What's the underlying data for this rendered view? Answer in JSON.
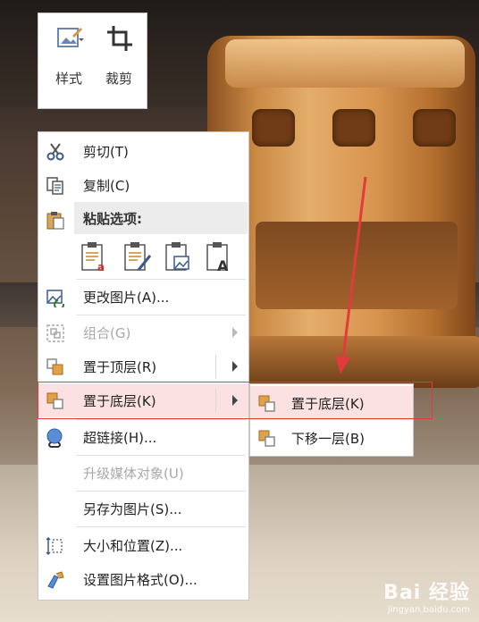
{
  "mini_toolbar": {
    "style_label": "样式",
    "crop_label": "裁剪"
  },
  "context_menu": {
    "cut": "剪切(T)",
    "copy": "复制(C)",
    "paste_options": "粘贴选项:",
    "change_picture": "更改图片(A)...",
    "group": "组合(G)",
    "bring_to_front": "置于顶层(R)",
    "send_to_back": "置于底层(K)",
    "hyperlink": "超链接(H)...",
    "upgrade_media": "升级媒体对象(U)",
    "save_as_picture": "另存为图片(S)...",
    "size_position": "大小和位置(Z)...",
    "format_picture": "设置图片格式(O)..."
  },
  "submenu": {
    "send_to_back": "置于底层(K)",
    "send_backward": "下移一层(B)"
  },
  "watermark": {
    "brand": "Bai 经验",
    "url": "jingyan.baidu.com"
  },
  "colors": {
    "highlight": "#fbe1e1",
    "annotation_red": "#e23b3b"
  },
  "icons": [
    "palette-icon",
    "crop-icon",
    "scissors-icon",
    "copy-icon",
    "clipboard-icon",
    "change-picture-icon",
    "group-icon",
    "bring-front-icon",
    "send-back-icon",
    "hyperlink-icon",
    "size-icon",
    "format-picture-icon"
  ]
}
